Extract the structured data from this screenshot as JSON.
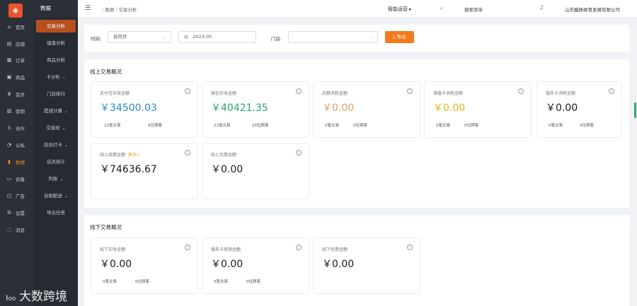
{
  "sidebar_main": {
    "logo_icon": "store-logo-icon",
    "items": [
      {
        "label": "首页",
        "icon": "home-icon"
      },
      {
        "label": "店铺",
        "icon": "shop-icon"
      },
      {
        "label": "订单",
        "icon": "order-icon"
      },
      {
        "label": "商品",
        "icon": "goods-icon"
      },
      {
        "label": "会员",
        "icon": "member-icon"
      },
      {
        "label": "营销",
        "icon": "marketing-icon"
      },
      {
        "label": "合伙",
        "icon": "partner-icon"
      },
      {
        "label": "公私",
        "icon": "public-private-icon"
      },
      {
        "label": "数据",
        "icon": "data-icon",
        "active": true
      },
      {
        "label": "设备",
        "icon": "device-icon"
      },
      {
        "label": "广告",
        "icon": "ad-icon"
      },
      {
        "label": "设置",
        "icon": "settings-icon"
      },
      {
        "label": "消息",
        "icon": "message-icon"
      }
    ]
  },
  "sidebar_sub": {
    "title": "数据",
    "items": [
      {
        "label": "交易分析",
        "active": true
      },
      {
        "label": "储值分析"
      },
      {
        "label": "商品分析"
      },
      {
        "label": "卡分析",
        "chevron": true
      },
      {
        "label": "门店排行"
      },
      {
        "label": "提成计算",
        "chevron": true
      },
      {
        "label": "交接班",
        "chevron": true
      },
      {
        "label": "店员打卡",
        "chevron": true
      },
      {
        "label": "店员统计"
      },
      {
        "label": "判账",
        "chevron": true
      },
      {
        "label": "自助配送",
        "chevron": true
      },
      {
        "label": "导出任务"
      }
    ]
  },
  "header": {
    "breadcrumb_root": "数据",
    "breadcrumb_current": "交易分析",
    "smart_ops": "智能运营",
    "search_placeholder": "搜索菜单",
    "company": "山东蹦扬体育发展有限公司"
  },
  "filter": {
    "time_label": "时间:",
    "period_value": "自然月",
    "date_value": "2023-05",
    "store_label": "门店:",
    "store_value": "",
    "export_label": "导出"
  },
  "online": {
    "title": "线上交易概况",
    "cards": [
      {
        "label": "支付宝实收金额",
        "amount": "￥34500.03",
        "count": "12笔交易",
        "customers": "9位顾客",
        "color": "#2a8bc9"
      },
      {
        "label": "微信实收金额",
        "amount": "￥40421.35",
        "count": "22笔交易",
        "customers": "20位顾客",
        "color": "#2fa86c"
      },
      {
        "label": "余额消耗金额",
        "amount": "￥0.00",
        "count": "0笔交易",
        "customers": "0位顾客",
        "color": "#d9a36a"
      },
      {
        "label": "储值卡消耗金额",
        "amount": "￥0.00",
        "count": "0笔交易",
        "customers": "0位顾客",
        "color": "#e8b01a"
      },
      {
        "label": "服务卡消耗金额",
        "amount": "￥0.00",
        "count": "0笔交易",
        "customers": "0位顾客",
        "color": "#1a1a1a"
      },
      {
        "label": "线上结算金额",
        "more": "更多>",
        "amount": "￥74636.67"
      },
      {
        "label": "线上优惠金额",
        "amount": "￥0.00"
      }
    ]
  },
  "offline": {
    "title": "线下交易概况",
    "cards": [
      {
        "label": "线下实收金额",
        "amount": "￥0.00",
        "count": "0笔交易",
        "customers": "0位顾客"
      },
      {
        "label": "服务卡核销金额",
        "amount": "￥0.00",
        "count": "0笔交易",
        "customers": "0位顾客"
      },
      {
        "label": "线下优惠金额",
        "amount": "￥0.00"
      }
    ]
  },
  "watermark": {
    "text": "大数跨境",
    "mark": "ı₀₀"
  }
}
